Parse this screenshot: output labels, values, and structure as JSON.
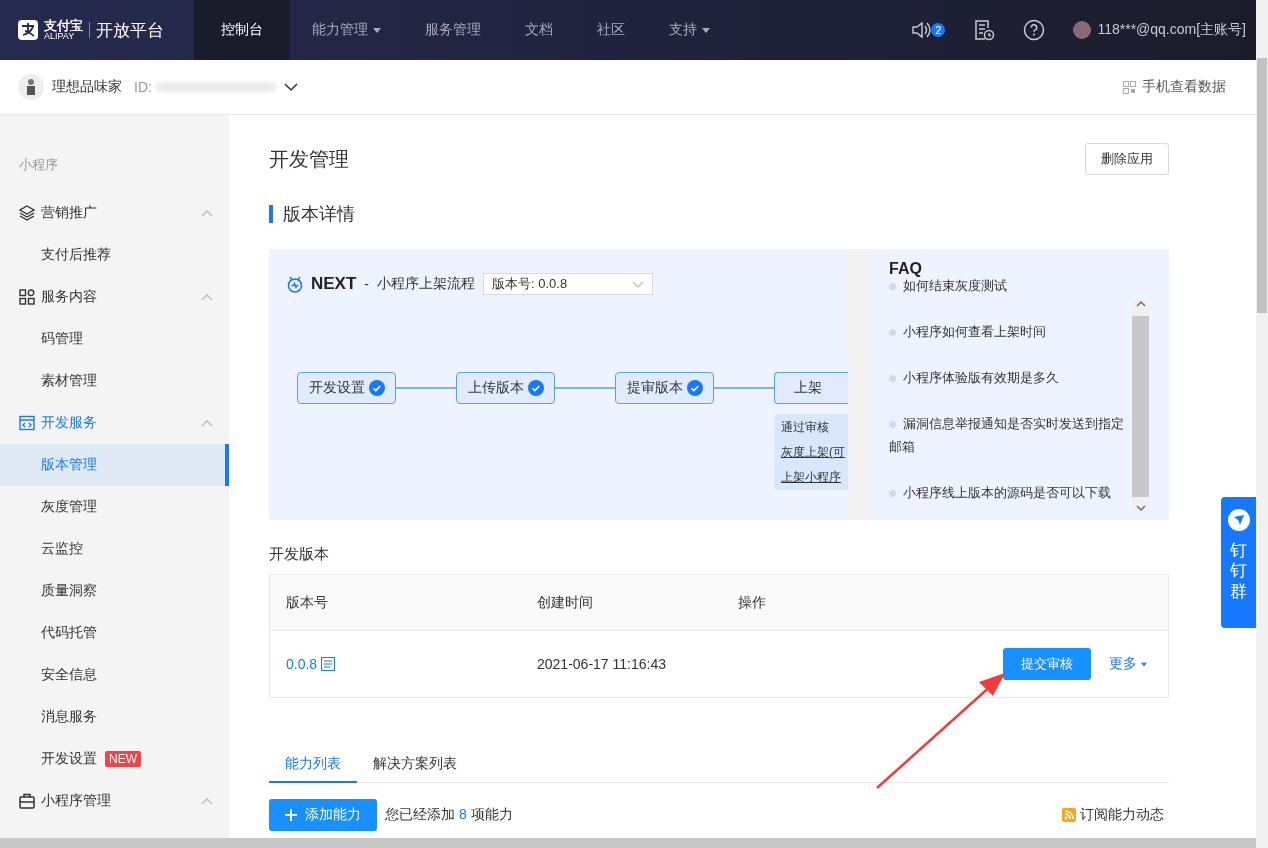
{
  "header": {
    "logo_text": "支付宝",
    "logo_sub": "ALIPAY",
    "platform": "开放平台",
    "nav": [
      {
        "label": "控制台",
        "selected": true,
        "dropdown": false
      },
      {
        "label": "能力管理",
        "selected": false,
        "dropdown": true
      },
      {
        "label": "服务管理",
        "selected": false,
        "dropdown": false
      },
      {
        "label": "文档",
        "selected": false,
        "dropdown": false
      },
      {
        "label": "社区",
        "selected": false,
        "dropdown": false
      },
      {
        "label": "支持",
        "selected": false,
        "dropdown": true
      }
    ],
    "notification_count": "2",
    "account": "118***@qq.com[主账号]"
  },
  "app_bar": {
    "app_name": "理想品味家",
    "id_label": "ID:",
    "mobile_link": "手机查看数据"
  },
  "sidebar": {
    "section": "小程序",
    "groups": [
      {
        "label": "营销推广",
        "kind": "layers",
        "expanded": true,
        "selected": false,
        "children": [
          {
            "label": "支付后推荐",
            "selected": false
          }
        ]
      },
      {
        "label": "服务内容",
        "kind": "grid",
        "expanded": true,
        "selected": false,
        "children": [
          {
            "label": "码管理",
            "selected": false
          },
          {
            "label": "素材管理",
            "selected": false
          }
        ]
      },
      {
        "label": "开发服务",
        "kind": "code",
        "expanded": true,
        "selected": true,
        "children": [
          {
            "label": "版本管理",
            "selected": true
          },
          {
            "label": "灰度管理",
            "selected": false
          },
          {
            "label": "云监控",
            "selected": false
          },
          {
            "label": "质量洞察",
            "selected": false
          },
          {
            "label": "代码托管",
            "selected": false
          },
          {
            "label": "安全信息",
            "selected": false
          },
          {
            "label": "消息服务",
            "selected": false
          },
          {
            "label": "开发设置",
            "selected": false,
            "badge": "NEW"
          }
        ]
      },
      {
        "label": "小程序管理",
        "kind": "box",
        "expanded": true,
        "selected": false
      }
    ]
  },
  "page": {
    "title": "开发管理",
    "delete_button": "删除应用",
    "section_title": "版本详情",
    "flow": {
      "brand": "NEXT",
      "separator": "-",
      "title": "小程序上架流程",
      "version_select": "版本号: 0.0.8",
      "steps": [
        {
          "label": "开发设置",
          "done": true
        },
        {
          "label": "上传版本",
          "done": true
        },
        {
          "label": "提审版本",
          "done": true
        },
        {
          "label": "上架",
          "done": false
        }
      ],
      "popup": [
        {
          "label": "通过审核",
          "link": false
        },
        {
          "label": "灰度上架(可",
          "link": true
        },
        {
          "label": "上架小程序",
          "link": true
        }
      ]
    },
    "faq": {
      "title": "FAQ",
      "items": [
        "如何结束灰度测试",
        "小程序如何查看上架时间",
        "小程序体验版有效期是多久",
        "漏洞信息举报通知是否实时发送到指定邮箱",
        "小程序线上版本的源码是否可以下载"
      ]
    },
    "dev_version": {
      "title": "开发版本",
      "columns": [
        "版本号",
        "创建时间",
        "操作"
      ],
      "rows": [
        {
          "version": "0.0.8",
          "created": "2021-06-17 11:16:43",
          "submit": "提交审核",
          "more": "更多"
        }
      ]
    },
    "tabs": [
      {
        "label": "能力列表",
        "selected": true
      },
      {
        "label": "解决方案列表",
        "selected": false
      }
    ],
    "add_button": "添加能力",
    "summary_prefix": "您已经添加",
    "summary_count": "8",
    "summary_suffix": "项能力",
    "subscribe_link": "订阅能力动态"
  },
  "chat_widget": {
    "label": "钉钉群"
  }
}
